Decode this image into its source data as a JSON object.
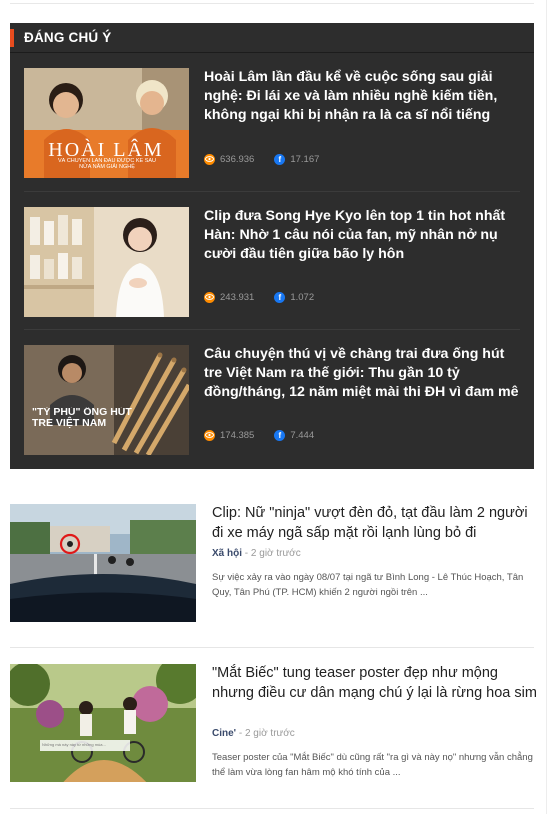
{
  "section": {
    "title": "ĐÁNG CHÚ Ý"
  },
  "featured": [
    {
      "title": "Hoài Lâm lần đầu kể về cuộc sống sau giải nghệ: Đi lái xe và làm nhiều nghề kiếm tiền, không ngại khi bị nhận ra là ca sĩ nổi tiếng",
      "views": "636.936",
      "shares": "17.167",
      "thumb_caption_big": "HOÀI LÂM",
      "thumb_caption_small": "VÀ CHUYỆN LẦN ĐẦU ĐƯỢC KỂ SAU NỬA NĂM GIẢI NGHỆ"
    },
    {
      "title": "Clip đưa Song Hye Kyo lên top 1 tin hot nhất Hàn: Nhờ 1 câu nói của fan, mỹ nhân nở nụ cười đầu tiên giữa bão ly hôn",
      "views": "243.931",
      "shares": "1.072"
    },
    {
      "title": "Câu chuyện thú vị về chàng trai đưa ống hút tre Việt Nam ra thế giới: Thu gần 10 tỷ đồng/tháng, 12 năm miệt mài thi ĐH vì đam mê",
      "views": "174.385",
      "shares": "7.444",
      "thumb_caption": "\"TỶ PHÚ\" ỐNG HÚT TRE VIỆT NAM"
    }
  ],
  "news": [
    {
      "title": "Clip: Nữ \"ninja\" vượt đèn đỏ, tạt đầu làm 2 người đi xe máy ngã sấp mặt rồi lạnh lùng bỏ đi",
      "category": "Xã hội",
      "time": "2 giờ trước",
      "sapo": "Sự việc xảy ra vào ngày 08/07 tại ngã tư Bình Long - Lê Thúc Hoạch, Tân Quy, Tân Phú (TP. HCM) khiến 2 người ngồi trên ..."
    },
    {
      "title": "\"Mắt Biếc\" tung teaser poster đẹp như mộng nhưng điều cư dân mạng chú ý lại là rừng hoa sim",
      "category": "Cine'",
      "time": "2 giờ trước",
      "sapo": "Teaser poster của \"Mắt Biếc\" dù cũng rất \"ra gì và này nọ\" nhưng vẫn chẳng thể làm vừa lòng fan hâm mộ khó tính của ...",
      "thumb_note": "Những mà này này từ những mùa..."
    }
  ],
  "labels": {
    "separator": "-"
  },
  "colors": {
    "accent": "#e84c1e",
    "dark_bg": "#2d2d2d",
    "views_icon": "#ff8c00",
    "facebook": "#1877f2"
  },
  "icons": {
    "views": "eye-icon",
    "shares": "facebook-icon"
  }
}
